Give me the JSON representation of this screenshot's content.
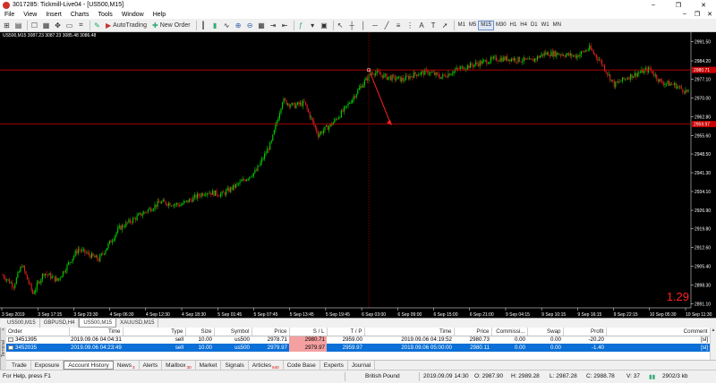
{
  "window": {
    "title": "3017285: Tickmill-Live04 - [US500,M15]",
    "controls": [
      "–",
      "❐",
      "✕"
    ]
  },
  "menu": [
    "File",
    "View",
    "Insert",
    "Charts",
    "Tools",
    "Window",
    "Help"
  ],
  "mdi_controls": [
    "–",
    "❐",
    "✕"
  ],
  "toolbar": {
    "autotrading_label": "AutoTrading",
    "new_order_label": "New Order",
    "timeframes": [
      "M1",
      "M5",
      "M15",
      "M30",
      "H1",
      "H4",
      "D1",
      "W1",
      "MN"
    ],
    "active_timeframe": "M15"
  },
  "chart": {
    "header": "US500,M15  3087.23 3087.23 3085.48 3086.48",
    "big_value": "1.29",
    "price_labels": [
      "2991.50",
      "2984.20",
      "2977.10",
      "2970.00",
      "2962.80",
      "2955.60",
      "2948.50",
      "2941.30",
      "2934.10",
      "2926.90",
      "2919.80",
      "2912.60",
      "2905.40",
      "2898.30",
      "2891.10"
    ],
    "time_labels": [
      "3 Sep 2019",
      "3 Sep 17:15",
      "3 Sep 23:30",
      "4 Sep 06:30",
      "4 Sep 12:30",
      "4 Sep 18:30",
      "5 Sep 01:45",
      "5 Sep 07:45",
      "5 Sep 13:45",
      "5 Sep 19:45",
      "6 Sep 03:00",
      "6 Sep 09:00",
      "6 Sep 15:00",
      "6 Sep 21:00",
      "9 Sep 04:15",
      "9 Sep 10:15",
      "9 Sep 16:15",
      "9 Sep 22:15",
      "10 Sep 05:30",
      "10 Sep 11:30"
    ],
    "level_labels": {
      "upper": "2980.71",
      "lower": "2959.97"
    },
    "bull_color": "#00d000",
    "bear_color": "#e02020",
    "level_color": "#c80000"
  },
  "chart_tabs": [
    {
      "label": "US500,M15",
      "active": false
    },
    {
      "label": "GBPUSD,H4",
      "active": false
    },
    {
      "label": "US500,M15",
      "active": true
    },
    {
      "label": "XAUUSD,M15",
      "active": false
    }
  ],
  "terminal": {
    "side_label": "Terminal",
    "close": "×",
    "columns": [
      "Order",
      "Time",
      "Type",
      "Size",
      "Symbol",
      "Price",
      "S / L",
      "T / P",
      "Time",
      "Price",
      "Commissi...",
      "Swap",
      "Profit",
      "Comment"
    ],
    "rows": [
      {
        "order": "3451395",
        "time": "2019.09.06 04:04:31",
        "type": "sell",
        "size": "10.00",
        "symbol": "us500",
        "price": "2978.71",
        "sl": "2980.71",
        "tp": "2959.00",
        "close_time": "2019.09.06 04:19:52",
        "close_price": "2980.73",
        "commission": "0.00",
        "swap": "0.00",
        "profit": "-20.20",
        "comment": "[sl]",
        "selected": false
      },
      {
        "order": "3452035",
        "time": "2019.09.06 04:23:49",
        "type": "sell",
        "size": "10.00",
        "symbol": "us500",
        "price": "2979.97",
        "sl": "2979.97",
        "tp": "2959.97",
        "close_time": "2019.09.06 05:00:00",
        "close_price": "2980.11",
        "commission": "0.00",
        "swap": "0.00",
        "profit": "-1.40",
        "comment": "[sl]",
        "selected": true
      }
    ]
  },
  "terminal_tabs": [
    {
      "label": "Trade",
      "count": ""
    },
    {
      "label": "Exposure",
      "count": ""
    },
    {
      "label": "Account History",
      "count": "",
      "active": true
    },
    {
      "label": "News",
      "count": "3"
    },
    {
      "label": "Alerts",
      "count": ""
    },
    {
      "label": "Mailbox",
      "count": "30"
    },
    {
      "label": "Market",
      "count": ""
    },
    {
      "label": "Signals",
      "count": ""
    },
    {
      "label": "Articles",
      "count": "640"
    },
    {
      "label": "Code Base",
      "count": ""
    },
    {
      "label": "Experts",
      "count": ""
    },
    {
      "label": "Journal",
      "count": ""
    }
  ],
  "status": {
    "help": "For Help, press F1",
    "profile": "British Pound",
    "datetime": "2019.09.09 14:30",
    "open": "O: 2987.90",
    "high": "H: 2989.28",
    "low": "L: 2987.28",
    "close": "C: 2988.78",
    "volume": "V: 37",
    "traffic": "2902/3 kb"
  }
}
